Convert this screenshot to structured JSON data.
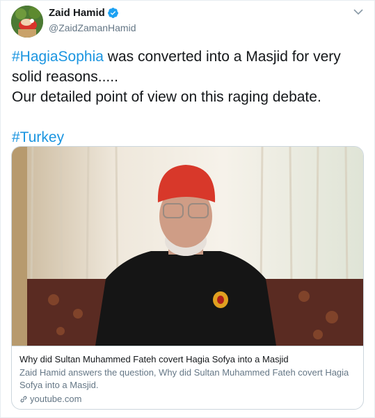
{
  "author": {
    "name": "Zaid Hamid",
    "handle": "@ZaidZamanHamid",
    "verified": true,
    "avatar_icon": "avatar-image"
  },
  "tweet": {
    "hashtag1": "#HagiaSophia",
    "line1_rest": " was converted into a Masjid for very",
    "line2": "solid reasons.....",
    "line3": "Our detailed point of view on this raging debate.",
    "hashtag2": "#Turkey"
  },
  "card": {
    "title": "Why did Sultan Muhammed Fateh covert Hagia Sofya into a Masjid",
    "description": "Zaid Hamid answers the question, Why did Sultan Muhammed Fateh covert Hagia Sofya into a Masjid.",
    "domain": "youtube.com",
    "image_icon": "video-thumbnail"
  },
  "colors": {
    "link": "#1b95e0",
    "text": "#14171a",
    "muted": "#657786",
    "border": "#ccd6dd"
  }
}
